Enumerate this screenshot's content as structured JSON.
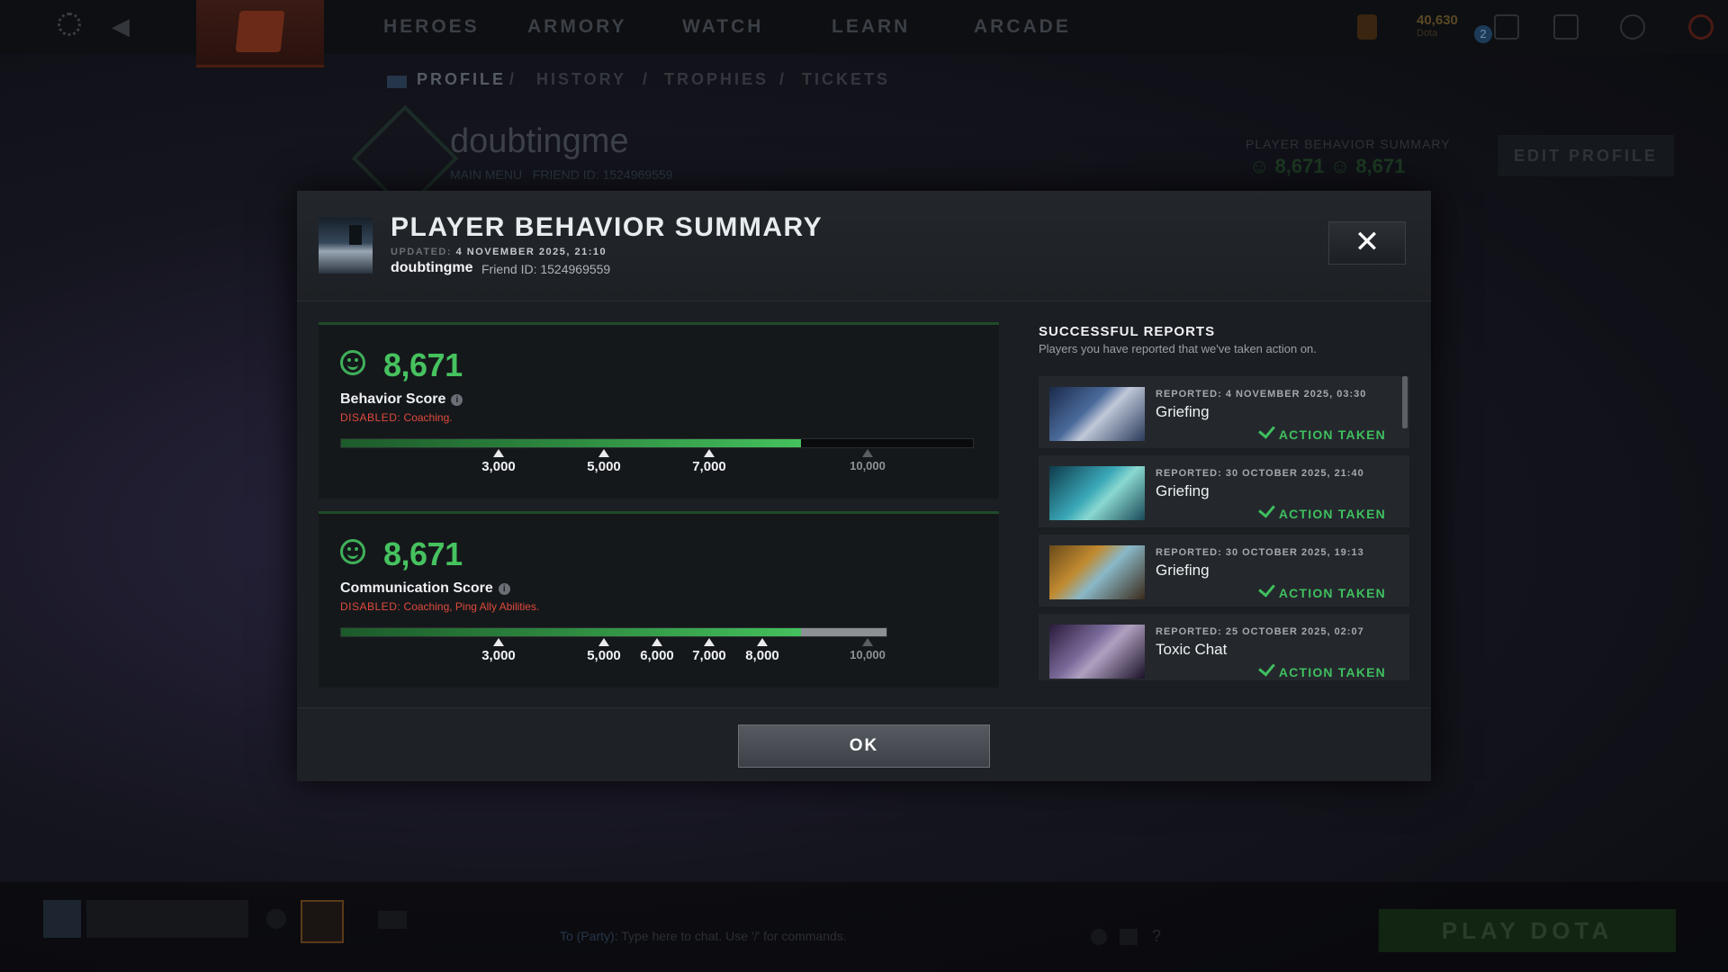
{
  "topbar": {
    "nav": [
      "HEROES",
      "ARMORY",
      "WATCH",
      "LEARN",
      "ARCADE"
    ],
    "currency_value": "40,630",
    "currency_label": "Dota",
    "notification_count": "2"
  },
  "subnav": [
    "PROFILE",
    "HISTORY",
    "TROPHIES",
    "TICKETS"
  ],
  "subnav_separator": "/",
  "background_profile": {
    "name": "doubtingme",
    "main_menu": "MAIN MENU",
    "friend_id": "FRIEND ID: 1524969559",
    "pbs_label": "PLAYER BEHAVIOR SUMMARY",
    "pbs_values": "☺ 8,671  ☺ 8,671",
    "edit_profile": "EDIT PROFILE"
  },
  "bottombar": {
    "chat_prefix": "To (Party):",
    "chat_placeholder": "Type here to chat. Use '/' for commands.",
    "help_icon": "?",
    "play_button": "PLAY DOTA"
  },
  "dialog": {
    "title": "PLAYER BEHAVIOR SUMMARY",
    "updated_label": "UPDATED:",
    "updated_value": "4 NOVEMBER 2025, 21:10",
    "player_name": "doubtingme",
    "friend_id": "Friend ID: 1524969559",
    "close_label": "✕",
    "ok_label": "OK",
    "behavior": {
      "value": "8,671",
      "label": "Behavior Score",
      "disabled_label": "DISABLED:",
      "disabled_value": "Coaching.",
      "progress_fraction": 0.8671,
      "ticks": [
        "3,000",
        "5,000",
        "7,000",
        "10,000"
      ]
    },
    "communication": {
      "value": "8,671",
      "label": "Communication Score",
      "disabled_label": "DISABLED:",
      "disabled_value": "Coaching, Ping Ally Abilities.",
      "progress_fraction": 0.8671,
      "ticks": [
        "3,000",
        "5,000",
        "6,000",
        "7,000",
        "8,000",
        "10,000"
      ]
    },
    "reports": {
      "title": "SUCCESSFUL REPORTS",
      "subtitle": "Players you have reported that we've taken action on.",
      "items": [
        {
          "date": "REPORTED: 4 NOVEMBER 2025, 03:30",
          "reason": "Griefing",
          "action": "ACTION TAKEN",
          "hero_icon": "drow-ranger-portrait"
        },
        {
          "date": "REPORTED: 30 OCTOBER 2025, 21:40",
          "reason": "Griefing",
          "action": "ACTION TAKEN",
          "hero_icon": "jakiro-portrait"
        },
        {
          "date": "REPORTED: 30 OCTOBER 2025, 19:13",
          "reason": "Griefing",
          "action": "ACTION TAKEN",
          "hero_icon": "tusk-portrait"
        },
        {
          "date": "REPORTED: 25 OCTOBER 2025, 02:07",
          "reason": "Toxic Chat",
          "action": "ACTION TAKEN",
          "hero_icon": "bane-portrait"
        }
      ]
    }
  },
  "colors": {
    "score_green": "#46c25f",
    "disabled_red": "#e04a3c",
    "action_green": "#3fbf5e"
  }
}
